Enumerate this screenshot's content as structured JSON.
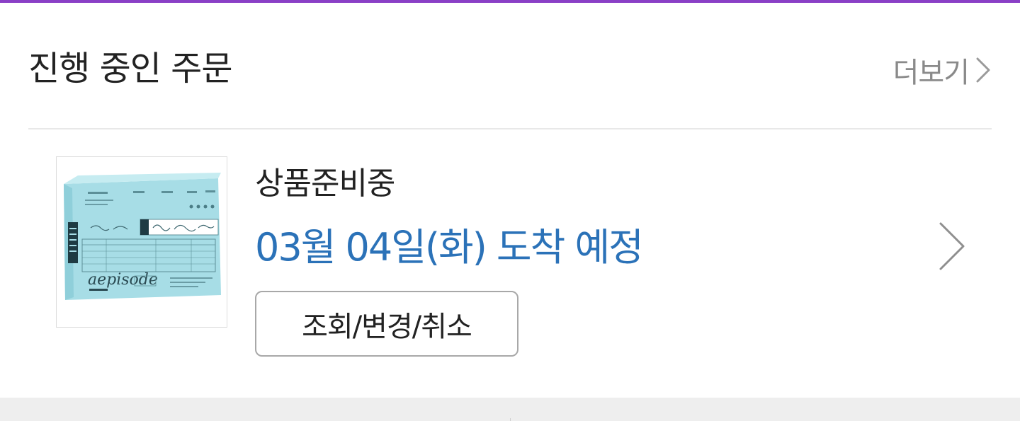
{
  "colors": {
    "accent_bar": "#8a3fc6",
    "eta_text": "#2b72b8",
    "muted_text": "#8a8a8a",
    "primary_text": "#222222",
    "divider": "#e8e8e8",
    "bottom_band": "#eeeeee",
    "button_border": "#a8a8a8"
  },
  "section": {
    "title": "진행 중인 주문",
    "more_label": "더보기",
    "more_icon": "chevron-right-icon"
  },
  "order": {
    "thumbnail_icon": "album-package-image",
    "thumbnail_logo": "aepisode",
    "status": "상품준비중",
    "eta": "03월 04일(화) 도착 예정",
    "manage_button_label": "조회/변경/취소",
    "detail_icon": "chevron-right-icon"
  }
}
